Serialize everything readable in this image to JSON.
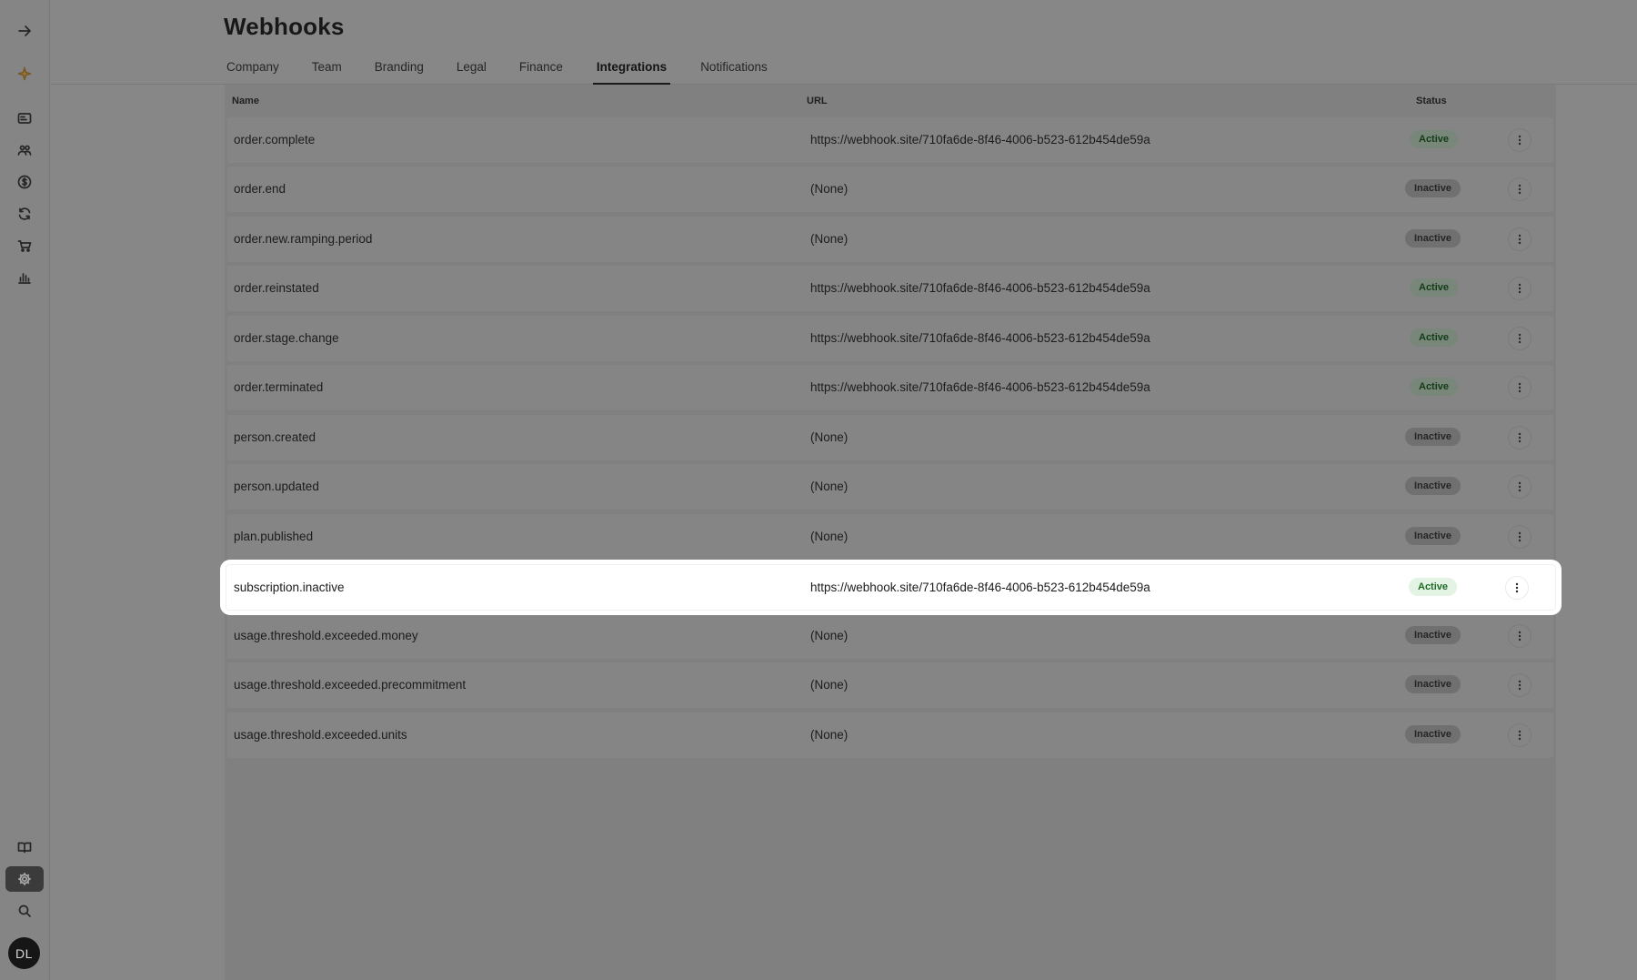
{
  "page": {
    "title": "Webhooks"
  },
  "tabs": [
    {
      "label": "Company"
    },
    {
      "label": "Team"
    },
    {
      "label": "Branding"
    },
    {
      "label": "Legal"
    },
    {
      "label": "Finance"
    },
    {
      "label": "Integrations",
      "active": true
    },
    {
      "label": "Notifications"
    }
  ],
  "table": {
    "columns": {
      "name": "Name",
      "url": "URL",
      "status": "Status"
    },
    "rows": [
      {
        "name": "order.complete",
        "url": "https://webhook.site/710fa6de-8f46-4006-b523-612b454de59a",
        "status": "Active"
      },
      {
        "name": "order.end",
        "url": "(None)",
        "status": "Inactive"
      },
      {
        "name": "order.new.ramping.period",
        "url": "(None)",
        "status": "Inactive"
      },
      {
        "name": "order.reinstated",
        "url": "https://webhook.site/710fa6de-8f46-4006-b523-612b454de59a",
        "status": "Active"
      },
      {
        "name": "order.stage.change",
        "url": "https://webhook.site/710fa6de-8f46-4006-b523-612b454de59a",
        "status": "Active"
      },
      {
        "name": "order.terminated",
        "url": "https://webhook.site/710fa6de-8f46-4006-b523-612b454de59a",
        "status": "Active"
      },
      {
        "name": "person.created",
        "url": "(None)",
        "status": "Inactive"
      },
      {
        "name": "person.updated",
        "url": "(None)",
        "status": "Inactive"
      },
      {
        "name": "plan.published",
        "url": "(None)",
        "status": "Inactive"
      },
      {
        "name": "subscription.inactive",
        "url": "https://webhook.site/710fa6de-8f46-4006-b523-612b454de59a",
        "status": "Active",
        "highlighted": true
      },
      {
        "name": "usage.threshold.exceeded.money",
        "url": "(None)",
        "status": "Inactive"
      },
      {
        "name": "usage.threshold.exceeded.precommitment",
        "url": "(None)",
        "status": "Inactive"
      },
      {
        "name": "usage.threshold.exceeded.units",
        "url": "(None)",
        "status": "Inactive"
      }
    ]
  },
  "sidebar": {
    "icons": [
      "expand-arrow-icon",
      "sparkle-icon",
      "id-card-icon",
      "users-icon",
      "dollar-icon",
      "refresh-icon",
      "cart-icon",
      "bar-chart-icon",
      "book-icon",
      "gear-icon",
      "search-icon"
    ],
    "user_initials": "DL"
  },
  "colors": {
    "active_badge_bg": "#e3f3e4",
    "active_badge_text": "#1f6b26",
    "overlay": "#878787"
  }
}
